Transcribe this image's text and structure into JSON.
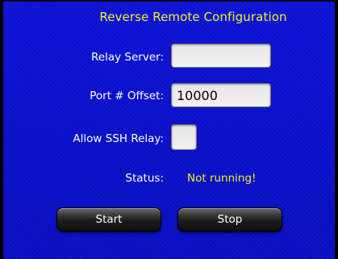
{
  "title": "Reverse Remote Configuration",
  "form": {
    "relay_server": {
      "label": "Relay Server:",
      "value": ""
    },
    "port_offset": {
      "label": "Port # Offset:",
      "value": "10000"
    },
    "allow_ssh_relay": {
      "label": "Allow SSH Relay:",
      "checked": false
    },
    "status": {
      "label": "Status:",
      "value": "Not running!"
    }
  },
  "buttons": {
    "start_label": "Start",
    "stop_label": "Stop"
  },
  "colors": {
    "background": "#0a10c9",
    "accent_text": "#f4f02a",
    "label_text": "#ffffff",
    "button_bg": "#1c1c1c"
  }
}
